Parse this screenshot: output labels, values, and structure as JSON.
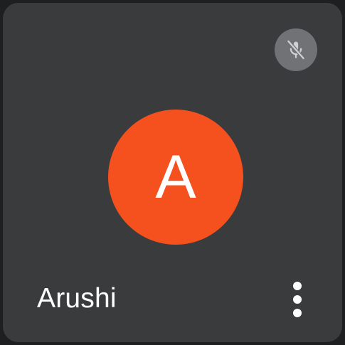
{
  "participant": {
    "name": "Arushi",
    "initial": "A",
    "muted": true
  },
  "icons": {
    "mute": "mic-off-icon",
    "more": "more-vert-icon"
  },
  "colors": {
    "tile_background": "#3a3b3d",
    "avatar_background": "#f4511e",
    "mute_badge_background": "#707275",
    "text": "#ffffff"
  }
}
